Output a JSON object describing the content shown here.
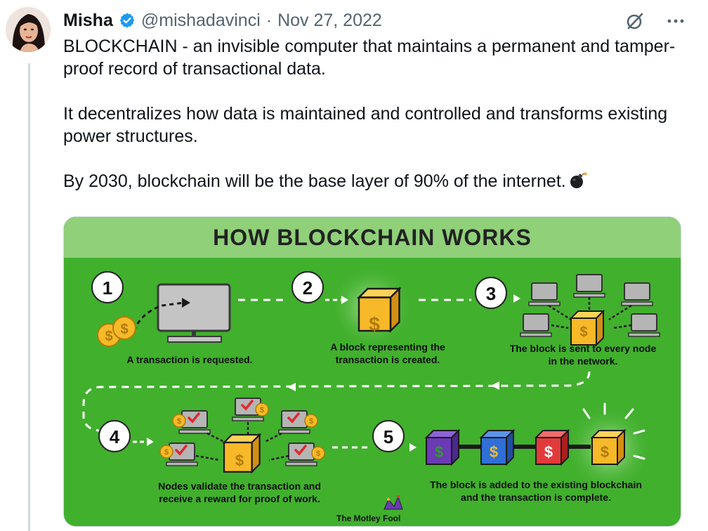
{
  "author": {
    "name": "Misha",
    "handle": "@mishadavinci",
    "separator": "·",
    "date": "Nov 27, 2022",
    "verified": true,
    "avatar_icon": "profile-photo"
  },
  "actions": {
    "grok_icon": "grok-icon",
    "more_icon": "more-horizontal-icon"
  },
  "tweet": {
    "paragraph_1": "BLOCKCHAIN - an invisible computer that maintains a permanent and tamper-proof record of transactional data.",
    "paragraph_2": "It decentralizes how data is maintained and controlled and transforms existing power structures.",
    "paragraph_3": "By 2030, blockchain will be the base layer of 90% of the internet.",
    "emoji": "bomb-emoji"
  },
  "infographic": {
    "title": "HOW BLOCKCHAIN WORKS",
    "steps": [
      {
        "number": "1",
        "caption": "A transaction is requested."
      },
      {
        "number": "2",
        "caption": "A block representing the transaction is created."
      },
      {
        "number": "3",
        "caption": "The block is sent to every node in the network."
      },
      {
        "number": "4",
        "caption": "Nodes validate the transaction and receive a reward for proof of work."
      },
      {
        "number": "5",
        "caption": "The block is added to the existing blockchain and the transaction is complete."
      }
    ],
    "currency_symbol": "$",
    "brand": "The Motley Fool",
    "colors": {
      "background": "#41b02d",
      "title_bar": "#8fd079",
      "block": "#f7b928",
      "chain_purple": "#6a3bb5",
      "chain_blue": "#2f6fd6",
      "chain_red": "#e23a3a"
    }
  }
}
